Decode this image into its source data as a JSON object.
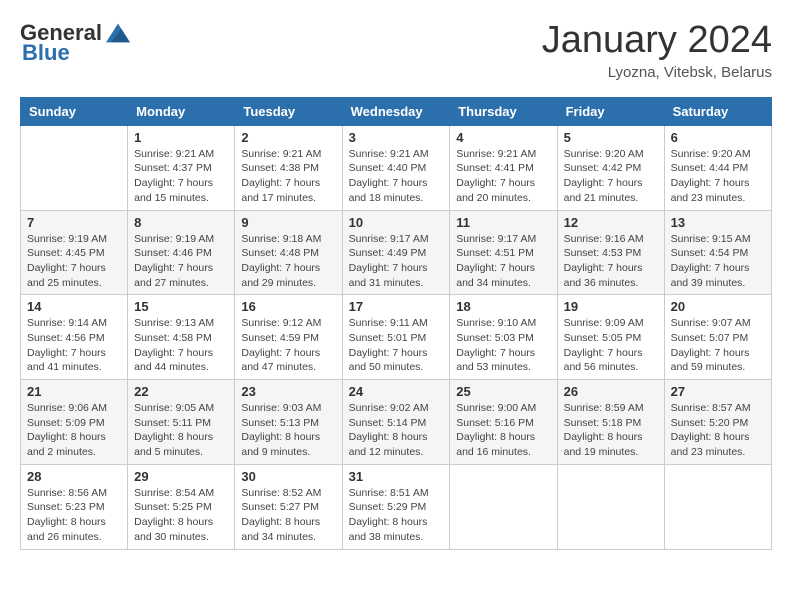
{
  "logo": {
    "general": "General",
    "blue": "Blue"
  },
  "header": {
    "month": "January 2024",
    "location": "Lyozna, Vitebsk, Belarus"
  },
  "weekdays": [
    "Sunday",
    "Monday",
    "Tuesday",
    "Wednesday",
    "Thursday",
    "Friday",
    "Saturday"
  ],
  "weeks": [
    [
      {
        "day": "",
        "sunrise": "",
        "sunset": "",
        "daylight": ""
      },
      {
        "day": "1",
        "sunrise": "Sunrise: 9:21 AM",
        "sunset": "Sunset: 4:37 PM",
        "daylight": "Daylight: 7 hours and 15 minutes."
      },
      {
        "day": "2",
        "sunrise": "Sunrise: 9:21 AM",
        "sunset": "Sunset: 4:38 PM",
        "daylight": "Daylight: 7 hours and 17 minutes."
      },
      {
        "day": "3",
        "sunrise": "Sunrise: 9:21 AM",
        "sunset": "Sunset: 4:40 PM",
        "daylight": "Daylight: 7 hours and 18 minutes."
      },
      {
        "day": "4",
        "sunrise": "Sunrise: 9:21 AM",
        "sunset": "Sunset: 4:41 PM",
        "daylight": "Daylight: 7 hours and 20 minutes."
      },
      {
        "day": "5",
        "sunrise": "Sunrise: 9:20 AM",
        "sunset": "Sunset: 4:42 PM",
        "daylight": "Daylight: 7 hours and 21 minutes."
      },
      {
        "day": "6",
        "sunrise": "Sunrise: 9:20 AM",
        "sunset": "Sunset: 4:44 PM",
        "daylight": "Daylight: 7 hours and 23 minutes."
      }
    ],
    [
      {
        "day": "7",
        "sunrise": "Sunrise: 9:19 AM",
        "sunset": "Sunset: 4:45 PM",
        "daylight": "Daylight: 7 hours and 25 minutes."
      },
      {
        "day": "8",
        "sunrise": "Sunrise: 9:19 AM",
        "sunset": "Sunset: 4:46 PM",
        "daylight": "Daylight: 7 hours and 27 minutes."
      },
      {
        "day": "9",
        "sunrise": "Sunrise: 9:18 AM",
        "sunset": "Sunset: 4:48 PM",
        "daylight": "Daylight: 7 hours and 29 minutes."
      },
      {
        "day": "10",
        "sunrise": "Sunrise: 9:17 AM",
        "sunset": "Sunset: 4:49 PM",
        "daylight": "Daylight: 7 hours and 31 minutes."
      },
      {
        "day": "11",
        "sunrise": "Sunrise: 9:17 AM",
        "sunset": "Sunset: 4:51 PM",
        "daylight": "Daylight: 7 hours and 34 minutes."
      },
      {
        "day": "12",
        "sunrise": "Sunrise: 9:16 AM",
        "sunset": "Sunset: 4:53 PM",
        "daylight": "Daylight: 7 hours and 36 minutes."
      },
      {
        "day": "13",
        "sunrise": "Sunrise: 9:15 AM",
        "sunset": "Sunset: 4:54 PM",
        "daylight": "Daylight: 7 hours and 39 minutes."
      }
    ],
    [
      {
        "day": "14",
        "sunrise": "Sunrise: 9:14 AM",
        "sunset": "Sunset: 4:56 PM",
        "daylight": "Daylight: 7 hours and 41 minutes."
      },
      {
        "day": "15",
        "sunrise": "Sunrise: 9:13 AM",
        "sunset": "Sunset: 4:58 PM",
        "daylight": "Daylight: 7 hours and 44 minutes."
      },
      {
        "day": "16",
        "sunrise": "Sunrise: 9:12 AM",
        "sunset": "Sunset: 4:59 PM",
        "daylight": "Daylight: 7 hours and 47 minutes."
      },
      {
        "day": "17",
        "sunrise": "Sunrise: 9:11 AM",
        "sunset": "Sunset: 5:01 PM",
        "daylight": "Daylight: 7 hours and 50 minutes."
      },
      {
        "day": "18",
        "sunrise": "Sunrise: 9:10 AM",
        "sunset": "Sunset: 5:03 PM",
        "daylight": "Daylight: 7 hours and 53 minutes."
      },
      {
        "day": "19",
        "sunrise": "Sunrise: 9:09 AM",
        "sunset": "Sunset: 5:05 PM",
        "daylight": "Daylight: 7 hours and 56 minutes."
      },
      {
        "day": "20",
        "sunrise": "Sunrise: 9:07 AM",
        "sunset": "Sunset: 5:07 PM",
        "daylight": "Daylight: 7 hours and 59 minutes."
      }
    ],
    [
      {
        "day": "21",
        "sunrise": "Sunrise: 9:06 AM",
        "sunset": "Sunset: 5:09 PM",
        "daylight": "Daylight: 8 hours and 2 minutes."
      },
      {
        "day": "22",
        "sunrise": "Sunrise: 9:05 AM",
        "sunset": "Sunset: 5:11 PM",
        "daylight": "Daylight: 8 hours and 5 minutes."
      },
      {
        "day": "23",
        "sunrise": "Sunrise: 9:03 AM",
        "sunset": "Sunset: 5:13 PM",
        "daylight": "Daylight: 8 hours and 9 minutes."
      },
      {
        "day": "24",
        "sunrise": "Sunrise: 9:02 AM",
        "sunset": "Sunset: 5:14 PM",
        "daylight": "Daylight: 8 hours and 12 minutes."
      },
      {
        "day": "25",
        "sunrise": "Sunrise: 9:00 AM",
        "sunset": "Sunset: 5:16 PM",
        "daylight": "Daylight: 8 hours and 16 minutes."
      },
      {
        "day": "26",
        "sunrise": "Sunrise: 8:59 AM",
        "sunset": "Sunset: 5:18 PM",
        "daylight": "Daylight: 8 hours and 19 minutes."
      },
      {
        "day": "27",
        "sunrise": "Sunrise: 8:57 AM",
        "sunset": "Sunset: 5:20 PM",
        "daylight": "Daylight: 8 hours and 23 minutes."
      }
    ],
    [
      {
        "day": "28",
        "sunrise": "Sunrise: 8:56 AM",
        "sunset": "Sunset: 5:23 PM",
        "daylight": "Daylight: 8 hours and 26 minutes."
      },
      {
        "day": "29",
        "sunrise": "Sunrise: 8:54 AM",
        "sunset": "Sunset: 5:25 PM",
        "daylight": "Daylight: 8 hours and 30 minutes."
      },
      {
        "day": "30",
        "sunrise": "Sunrise: 8:52 AM",
        "sunset": "Sunset: 5:27 PM",
        "daylight": "Daylight: 8 hours and 34 minutes."
      },
      {
        "day": "31",
        "sunrise": "Sunrise: 8:51 AM",
        "sunset": "Sunset: 5:29 PM",
        "daylight": "Daylight: 8 hours and 38 minutes."
      },
      {
        "day": "",
        "sunrise": "",
        "sunset": "",
        "daylight": ""
      },
      {
        "day": "",
        "sunrise": "",
        "sunset": "",
        "daylight": ""
      },
      {
        "day": "",
        "sunrise": "",
        "sunset": "",
        "daylight": ""
      }
    ]
  ]
}
